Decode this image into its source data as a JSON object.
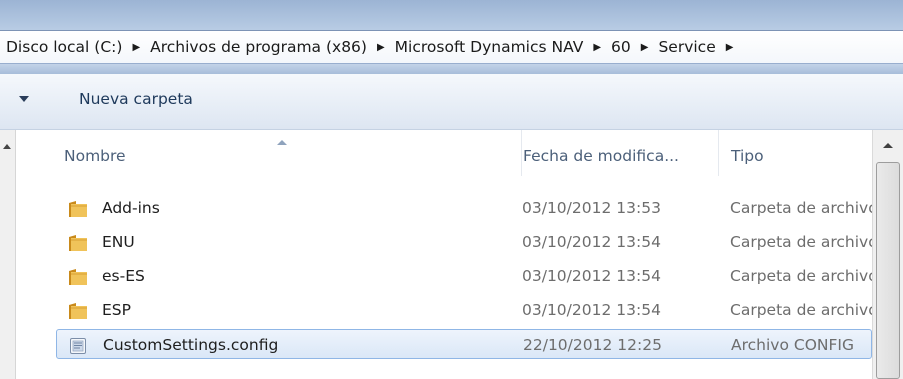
{
  "breadcrumb": {
    "items": [
      "Disco local (C:)",
      "Archivos de programa (x86)",
      "Microsoft Dynamics NAV",
      "60",
      "Service"
    ],
    "separator_icon": "triangle-right"
  },
  "toolbar": {
    "new_folder_label": "Nueva carpeta"
  },
  "columns": {
    "name": "Nombre",
    "date": "Fecha de modifica...",
    "type": "Tipo",
    "sorted_by": "name"
  },
  "files": [
    {
      "name": "Add-ins",
      "date": "03/10/2012 13:53",
      "type": "Carpeta de archivos",
      "icon": "folder-icon",
      "selected": false
    },
    {
      "name": "ENU",
      "date": "03/10/2012 13:54",
      "type": "Carpeta de archivos",
      "icon": "folder-icon",
      "selected": false
    },
    {
      "name": "es-ES",
      "date": "03/10/2012 13:54",
      "type": "Carpeta de archivos",
      "icon": "folder-icon",
      "selected": false
    },
    {
      "name": "ESP",
      "date": "03/10/2012 13:54",
      "type": "Carpeta de archivos",
      "icon": "folder-icon",
      "selected": false
    },
    {
      "name": "CustomSettings.config",
      "date": "22/10/2012 12:25",
      "type": "Archivo CONFIG",
      "icon": "config-file-icon",
      "selected": true
    }
  ],
  "colors": {
    "accent": "#1e395b",
    "selection_border": "#8fb6e6",
    "folder": "#e8b04a"
  }
}
